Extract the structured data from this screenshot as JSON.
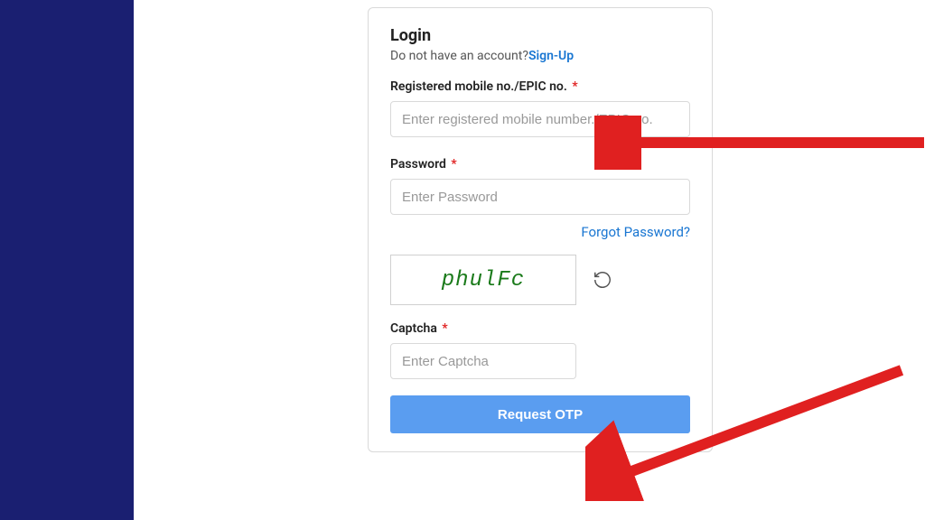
{
  "login": {
    "title": "Login",
    "signup_prompt": "Do not have an account?",
    "signup_link": "Sign-Up",
    "mobile_label": "Registered mobile no./EPIC no.",
    "mobile_placeholder": "Enter registered mobile number./EPIC no.",
    "password_label": "Password",
    "password_placeholder": "Enter Password",
    "forgot_link": "Forgot Password?",
    "captcha_value": "phulFc",
    "captcha_label": "Captcha",
    "captcha_placeholder": "Enter Captcha",
    "submit_label": "Request OTP"
  }
}
